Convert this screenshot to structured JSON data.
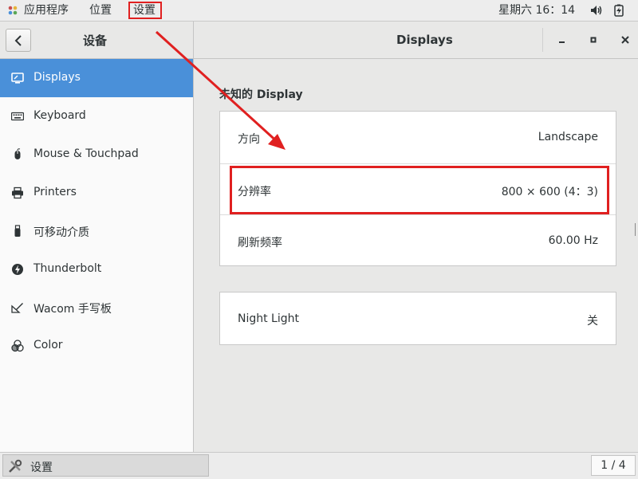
{
  "topbar": {
    "apps_label": "应用程序",
    "places_label": "位置",
    "settings_label": "设置",
    "clock": "星期六 16：14",
    "icons": [
      "app-menu-icon",
      "volume-icon",
      "battery-icon"
    ]
  },
  "sidebar": {
    "header_title": "设备",
    "items": [
      {
        "label": "Displays",
        "icon": "display-icon",
        "active": true
      },
      {
        "label": "Keyboard",
        "icon": "keyboard-icon"
      },
      {
        "label": "Mouse & Touchpad",
        "icon": "mouse-icon"
      },
      {
        "label": "Printers",
        "icon": "printer-icon"
      },
      {
        "label": "可移动介质",
        "icon": "usb-drive-icon"
      },
      {
        "label": "Thunderbolt",
        "icon": "thunderbolt-icon"
      },
      {
        "label": "Wacom 手写板",
        "icon": "tablet-pen-icon"
      },
      {
        "label": "Color",
        "icon": "color-icon"
      }
    ]
  },
  "main": {
    "header_title": "Displays",
    "section_title": "未知的  Display",
    "display_rows": [
      {
        "label": "方向",
        "value": "Landscape"
      },
      {
        "label": "分辨率",
        "value": "800 × 600 (4：3)"
      },
      {
        "label": "刷新频率",
        "value": "60.00 Hz"
      }
    ],
    "night_light": {
      "label": "Night Light",
      "value": "关"
    }
  },
  "taskbar": {
    "item_label": "设置",
    "pager": "1 / 4"
  },
  "colors": {
    "accent": "#4a90d9",
    "annotation": "#e02020"
  }
}
